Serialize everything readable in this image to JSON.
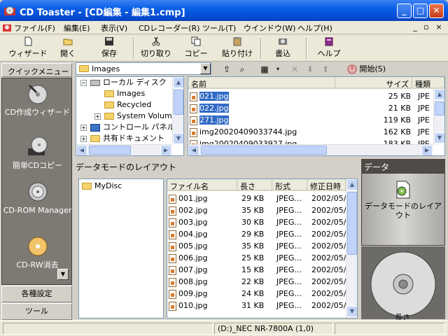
{
  "window": {
    "title": "CD Toaster - [CD編集 - 編集1.cmp]"
  },
  "menubar": {
    "items": [
      "ファイル(F)",
      "編集(E)",
      "表示(V)",
      "CDレコーダー(R)",
      "ツール(T)",
      "ウインドウ(W)",
      "ヘルプ(H)"
    ]
  },
  "toolbar": {
    "wizard": "ウィザード",
    "open": "開く",
    "save": "保存",
    "cut": "切り取り",
    "copy": "コピー",
    "paste": "貼り付け",
    "write": "書込",
    "help": "ヘルプ"
  },
  "quick": {
    "header": "クイックメニュー",
    "items": [
      "CD作成ウィザード",
      "簡単CDコピー",
      "CD-ROM Manager",
      "CD-RW消去"
    ],
    "settings": "各種設定",
    "tools": "ツール"
  },
  "browser": {
    "path": "Images",
    "start_label": "開始(S)",
    "tree": [
      "ローカル ディスク",
      "Images",
      "Recycled",
      "System Volum",
      "コントロール パネル",
      "共有ドキュメント"
    ],
    "columns": [
      "名前",
      "サイズ",
      "種類"
    ],
    "files": [
      {
        "name": "021.jpg",
        "size": "25 KB",
        "type": "JPE",
        "selected": true
      },
      {
        "name": "022.jpg",
        "size": "21 KB",
        "type": "JPE",
        "selected": true
      },
      {
        "name": "271.jpg",
        "size": "119 KB",
        "type": "JPE",
        "selected": true
      },
      {
        "name": "img20020409033744.jpg",
        "size": "162 KB",
        "type": "JPE",
        "selected": false
      },
      {
        "name": "img20020409033927.jpg",
        "size": "183 KB",
        "type": "JPE",
        "selected": false
      }
    ]
  },
  "layout": {
    "title": "データモードのレイアウト",
    "disc_name": "MyDisc",
    "columns": [
      "ファイル名",
      "長さ",
      "形式",
      "修正日時"
    ],
    "files": [
      {
        "name": "001.jpg",
        "size": "29 KB",
        "type": "JPEG...",
        "date": "2002/05/"
      },
      {
        "name": "002.jpg",
        "size": "35 KB",
        "type": "JPEG...",
        "date": "2002/05/"
      },
      {
        "name": "003.jpg",
        "size": "30 KB",
        "type": "JPEG...",
        "date": "2002/05/"
      },
      {
        "name": "004.jpg",
        "size": "29 KB",
        "type": "JPEG...",
        "date": "2002/05/"
      },
      {
        "name": "005.jpg",
        "size": "35 KB",
        "type": "JPEG...",
        "date": "2002/05/"
      },
      {
        "name": "006.jpg",
        "size": "25 KB",
        "type": "JPEG...",
        "date": "2002/05/"
      },
      {
        "name": "007.jpg",
        "size": "15 KB",
        "type": "JPEG...",
        "date": "2002/05/"
      },
      {
        "name": "008.jpg",
        "size": "22 KB",
        "type": "JPEG...",
        "date": "2002/05/"
      },
      {
        "name": "009.jpg",
        "size": "24 KB",
        "type": "JPEG...",
        "date": "2002/05/"
      },
      {
        "name": "010.jpg",
        "size": "31 KB",
        "type": "JPEG...",
        "date": "2002/05/"
      }
    ]
  },
  "data_panel": {
    "tab": "データ",
    "mode_label": "データモードのレイアウト",
    "disc_label": "長さ"
  },
  "statusbar": {
    "drive": "(D:)_NEC NR-7800A (1,0)"
  }
}
